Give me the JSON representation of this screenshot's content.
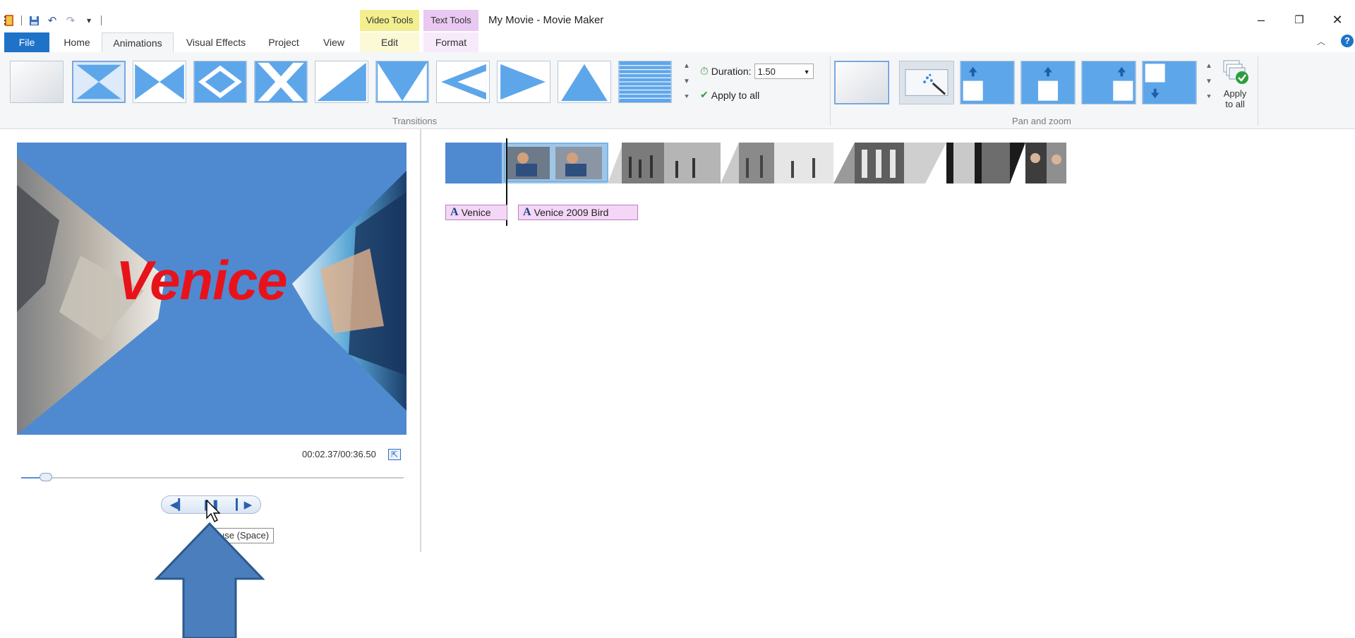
{
  "window": {
    "title": "My Movie - Movie Maker",
    "contextual_tabs": {
      "video_tools": "Video Tools",
      "text_tools": "Text Tools"
    },
    "controls": {
      "minimize": "–",
      "restore": "❐",
      "close": "✕"
    }
  },
  "ribbon_tabs": {
    "file": "File",
    "home": "Home",
    "animations": "Animations",
    "visual_effects": "Visual Effects",
    "project": "Project",
    "view": "View",
    "edit": "Edit",
    "format": "Format"
  },
  "transitions": {
    "group_label": "Transitions",
    "duration_label": "Duration:",
    "duration_value": "1.50",
    "apply_to_all": "Apply to all"
  },
  "pan_zoom": {
    "group_label": "Pan and zoom",
    "apply_to_all": "Apply to all"
  },
  "preview": {
    "overlay_text": "Venice",
    "timecode": "00:02.37/00:36.50",
    "progress_fraction": 0.065,
    "tooltip": "use (Space)"
  },
  "captions": [
    {
      "label": "Venice"
    },
    {
      "label": "Venice 2009 Bird"
    }
  ],
  "colors": {
    "accent": "#1e73c9",
    "video_tools": "#f3ef8f",
    "text_tools": "#e9c8f2",
    "preview_bg": "#4f8ad1",
    "title_red": "#e8131a"
  }
}
